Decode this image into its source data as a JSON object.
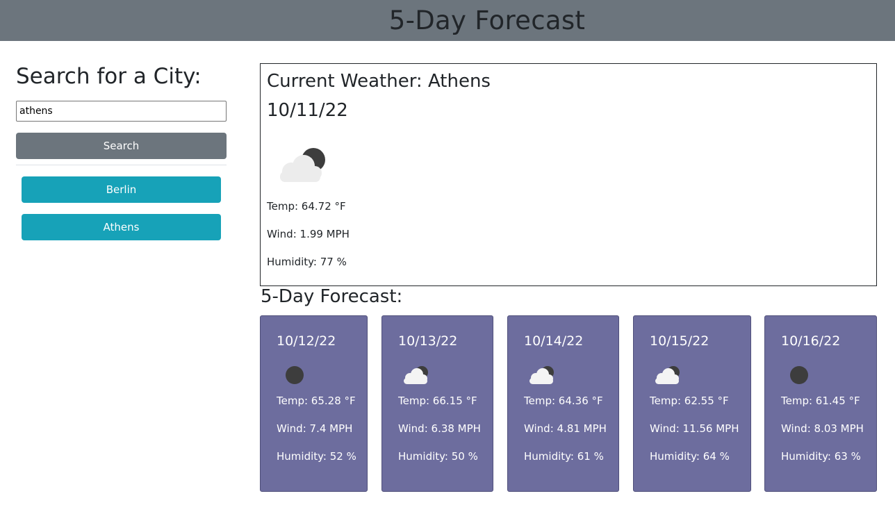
{
  "header": {
    "title": "5-Day Forecast"
  },
  "sidebar": {
    "title": "Search for a City:",
    "search_value": "athens",
    "search_button": "Search",
    "history": [
      "Berlin",
      "Athens"
    ]
  },
  "current": {
    "title": "Current Weather: Athens",
    "date": "10/11/22",
    "icon": "night-partly-cloudy-icon",
    "temp": "Temp: 64.72 °F",
    "wind": "Wind: 1.99 MPH",
    "humidity": "Humidity: 77 %"
  },
  "forecast": {
    "title": "5-Day Forecast:",
    "days": [
      {
        "date": "10/12/22",
        "icon": "moon-icon",
        "temp": "Temp: 65.28 °F",
        "wind": "Wind: 7.4 MPH",
        "humidity": "Humidity: 52 %"
      },
      {
        "date": "10/13/22",
        "icon": "night-cloud-icon",
        "temp": "Temp: 66.15 °F",
        "wind": "Wind: 6.38 MPH",
        "humidity": "Humidity: 50 %"
      },
      {
        "date": "10/14/22",
        "icon": "night-cloud-icon",
        "temp": "Temp: 64.36 °F",
        "wind": "Wind: 4.81 MPH",
        "humidity": "Humidity: 61 %"
      },
      {
        "date": "10/15/22",
        "icon": "night-cloud-icon",
        "temp": "Temp: 62.55 °F",
        "wind": "Wind: 11.56 MPH",
        "humidity": "Humidity: 64 %"
      },
      {
        "date": "10/16/22",
        "icon": "moon-icon",
        "temp": "Temp: 61.45 °F",
        "wind": "Wind: 8.03 MPH",
        "humidity": "Humidity: 63 %"
      }
    ]
  },
  "colors": {
    "header_bg": "#6c757d",
    "search_button": "#6c757d",
    "history_button": "#17a2b8",
    "card_bg": "#6d6d9e"
  }
}
